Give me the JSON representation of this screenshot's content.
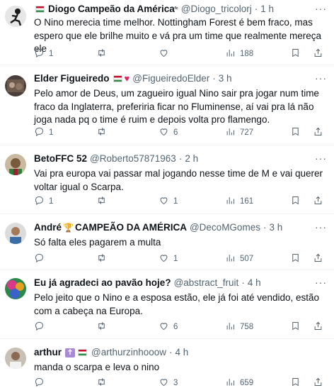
{
  "tweets": [
    {
      "name": "Diogo Campeão da América",
      "name_suffix": "ᶠᶜ",
      "handle": "@Diogo_tricolorj",
      "time": "1 h",
      "text": "O Nino merecia time melhor. Nottingham Forest é bem fraco, mas espero que ele brilhe muito e vá pra um time que realmente mereça ele",
      "replies": "1",
      "retweets": "",
      "likes": "",
      "views": "188"
    },
    {
      "name": "Elder Figueiredo",
      "handle": "@FigueiredoElder",
      "time": "3 h",
      "text": "Pelo amor de Deus, um zagueiro igual Nino sair pra jogar num time fraco da Inglaterra, preferiria ficar no Fluminense, aí vai pra lá não joga nada pq o time é ruim e depois volta pro flamengo.",
      "replies": "1",
      "retweets": "",
      "likes": "6",
      "views": "727"
    },
    {
      "name": "BetoFFC 52",
      "handle": "@Roberto57871963",
      "time": "2 h",
      "text": "Vai pra europa vai passar mal jogando nesse time de M e vai querer voltar igual o Scarpa.",
      "replies": "1",
      "retweets": "",
      "likes": "1",
      "views": "161"
    },
    {
      "name_prefix": "André",
      "name": "CAMPEÃO DA AMÉRICA",
      "handle": "@DecoMGomes",
      "time": "3 h",
      "text": "Só falta eles pagarem a multa",
      "replies": "",
      "retweets": "",
      "likes": "1",
      "views": "507"
    },
    {
      "name": "Eu já agradeci ao pavão hoje?",
      "handle": "@abstract_fruit",
      "time": "4 h",
      "text": "Pelo jeito que o Nino e a esposa estão, ele já foi até vendido, estão com a cabeça na Europa.",
      "replies": "",
      "retweets": "",
      "likes": "6",
      "views": "758"
    },
    {
      "name": "arthur",
      "handle": "@arthurzinhooow",
      "time": "4 h",
      "text": "manda o scarpa e leva o nino",
      "replies": "",
      "retweets": "",
      "likes": "3",
      "views": "659"
    }
  ],
  "separator": "·",
  "more_glyph": "···",
  "heart_glyph": "♥",
  "trophy_glyph": "🏆",
  "cross_glyph": "✝",
  "colors": {
    "text": "#0f1419",
    "secondary": "#536471",
    "border": "#eff3f4",
    "heart": "#e0245e"
  },
  "icons": [
    "reply-icon",
    "retweet-icon",
    "like-icon",
    "views-icon",
    "bookmark-icon",
    "share-icon",
    "more-icon",
    "flag-icon"
  ]
}
